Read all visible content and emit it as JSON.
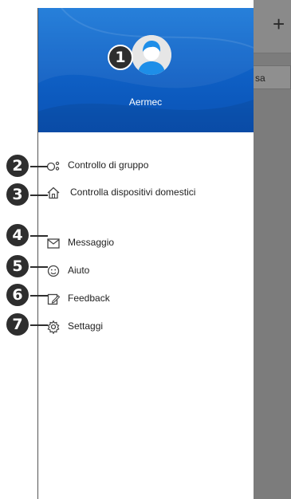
{
  "background_app": {
    "add_icon": "plus-icon",
    "field_fragment": "sa"
  },
  "drawer": {
    "avatar_icon": "user-avatar-icon",
    "username": "Aermec",
    "menu": [
      {
        "label": "Controllo di gruppo",
        "icon": "group-control-icon"
      },
      {
        "label": "Controlla dispositivi domestici",
        "icon": "home-icon"
      },
      {
        "label": "Messaggio",
        "icon": "envelope-icon"
      },
      {
        "label": "Aiuto",
        "icon": "help-smiley-icon"
      },
      {
        "label": "Feedback",
        "icon": "feedback-edit-icon"
      },
      {
        "label": "Settaggi",
        "icon": "gear-icon"
      }
    ]
  },
  "callouts": [
    "1",
    "2",
    "3",
    "4",
    "5",
    "6",
    "7"
  ],
  "colors": {
    "header_blue": "#0e5fc4",
    "callout_bg": "#2e2e2e",
    "overlay_gray": "#7c7c7c"
  }
}
